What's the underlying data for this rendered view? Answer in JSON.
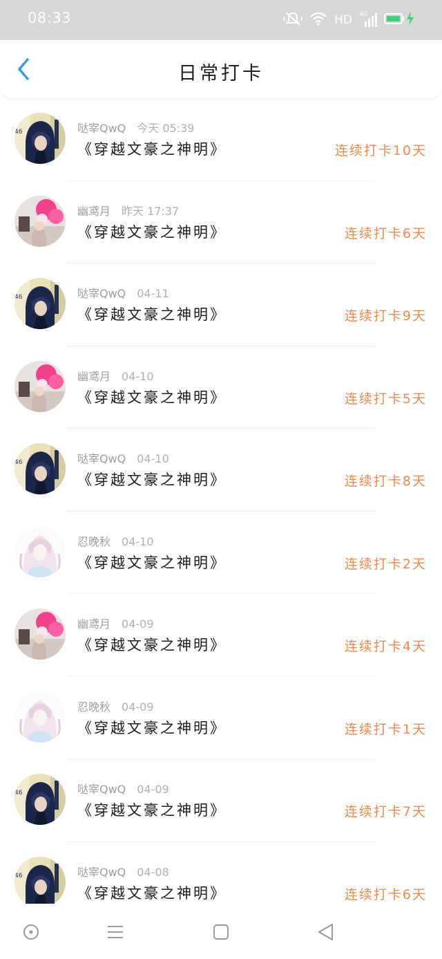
{
  "status_bar": {
    "time": "08:33",
    "network_label": "HD",
    "network_gen": "4G",
    "icons": [
      "mute-icon",
      "wifi-icon",
      "signal-icon",
      "battery-icon",
      "charging-icon"
    ]
  },
  "header": {
    "title": "日常打卡",
    "back_icon": "chevron-left-icon"
  },
  "colors": {
    "accent": "#ee8a4e",
    "back_blue": "#2e9af0",
    "status_bar": "#d7d7d7"
  },
  "list": {
    "items": [
      {
        "user": "哒宰QwQ",
        "date": "今天 05:39",
        "title": "《穿越文豪之神明》",
        "streak": "连续打卡10天",
        "avatar": "dazai"
      },
      {
        "user": "幽鸢月",
        "date": "昨天 17:37",
        "title": "《穿越文豪之神明》",
        "streak": "连续打卡6天",
        "avatar": "balloon"
      },
      {
        "user": "哒宰QwQ",
        "date": "04-11",
        "title": "《穿越文豪之神明》",
        "streak": "连续打卡9天",
        "avatar": "dazai"
      },
      {
        "user": "幽鸢月",
        "date": "04-10",
        "title": "《穿越文豪之神明》",
        "streak": "连续打卡5天",
        "avatar": "balloon"
      },
      {
        "user": "哒宰QwQ",
        "date": "04-10",
        "title": "《穿越文豪之神明》",
        "streak": "连续打卡8天",
        "avatar": "dazai"
      },
      {
        "user": "忍晚秋",
        "date": "04-10",
        "title": "《穿越文豪之神明》",
        "streak": "连续打卡2天",
        "avatar": "anime-girl"
      },
      {
        "user": "幽鸢月",
        "date": "04-09",
        "title": "《穿越文豪之神明》",
        "streak": "连续打卡4天",
        "avatar": "balloon"
      },
      {
        "user": "忍晚秋",
        "date": "04-09",
        "title": "《穿越文豪之神明》",
        "streak": "连续打卡1天",
        "avatar": "anime-girl"
      },
      {
        "user": "哒宰QwQ",
        "date": "04-09",
        "title": "《穿越文豪之神明》",
        "streak": "连续打卡7天",
        "avatar": "dazai"
      },
      {
        "user": "哒宰QwQ",
        "date": "04-08",
        "title": "《穿越文豪之神明》",
        "streak": "连续打卡6天",
        "avatar": "dazai"
      }
    ]
  },
  "bottom_nav": {
    "icons": [
      "home-circle-icon",
      "menu-icon",
      "recents-square-icon",
      "back-triangle-icon"
    ]
  }
}
